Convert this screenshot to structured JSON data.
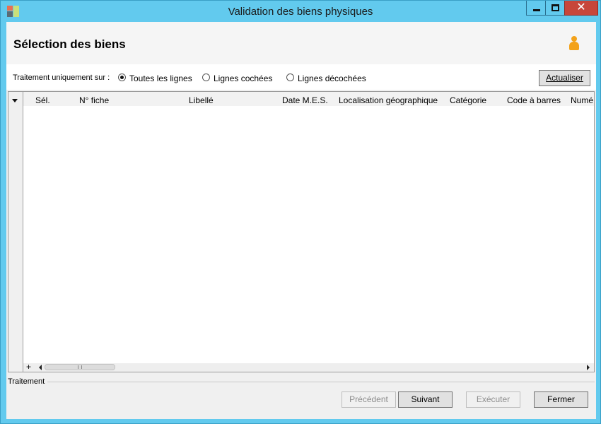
{
  "window": {
    "title": "Validation des biens physiques",
    "minimize_label": "",
    "close_label": "✕"
  },
  "header": {
    "title": "Sélection des biens"
  },
  "filter": {
    "label": "Traitement uniquement sur :",
    "options": [
      {
        "label": "Toutes les lignes",
        "checked": true
      },
      {
        "label": "Lignes cochées",
        "checked": false
      },
      {
        "label": "Lignes décochées",
        "checked": false
      }
    ],
    "refresh_label": "Actualiser"
  },
  "grid": {
    "columns": [
      "Sél.",
      "N° fiche",
      "Libellé",
      "Date M.E.S.",
      "Localisation géographique",
      "Catégorie",
      "Code à barres",
      "Numé"
    ],
    "rows": [],
    "add_symbol": "+"
  },
  "footer": {
    "group_label": "Traitement",
    "buttons": {
      "previous": "Précédent",
      "next": "Suivant",
      "execute": "Exécuter",
      "close": "Fermer"
    }
  },
  "colors": {
    "titlebar": "#62caee",
    "close_button": "#c7463a",
    "user_icon": "#f3a21a"
  }
}
